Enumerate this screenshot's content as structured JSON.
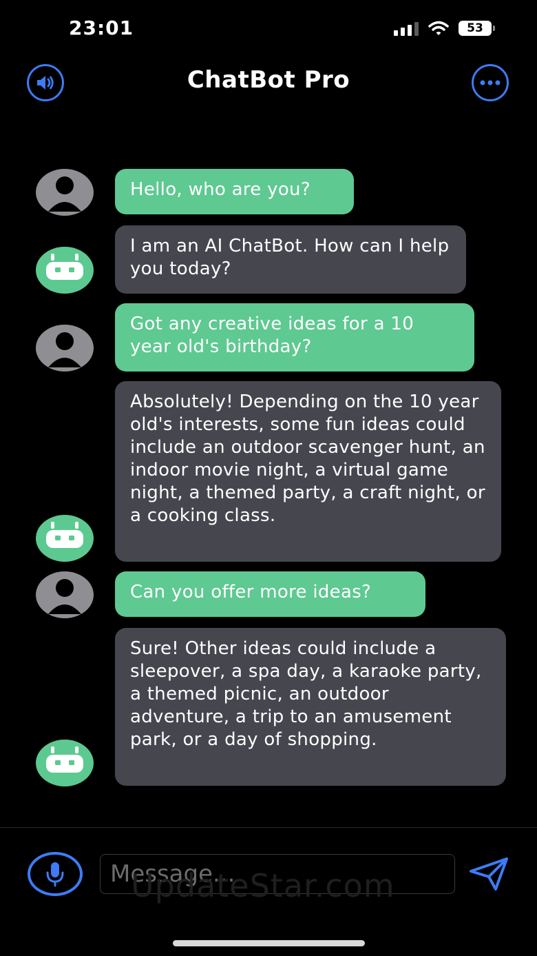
{
  "status_bar": {
    "time": "23:01",
    "battery_level": "53",
    "icons": [
      "signal-icon",
      "wifi-icon",
      "battery-icon"
    ]
  },
  "nav": {
    "title": "ChatBot Pro",
    "left_icon": "speaker-icon",
    "right_icon": "more-icon"
  },
  "messages": [
    {
      "sender": "user",
      "text": "Hello, who are you?"
    },
    {
      "sender": "bot",
      "text": "I am an AI ChatBot. How can I help you today?"
    },
    {
      "sender": "user",
      "text": "Got any creative ideas for a 10 year old's birthday?"
    },
    {
      "sender": "bot",
      "text": "Absolutely! Depending on the 10 year old's interests, some fun ideas could include an outdoor scavenger hunt, an indoor movie night, a virtual game night, a themed party, a craft night, or a cooking class."
    },
    {
      "sender": "user",
      "text": "Can you offer more ideas?"
    },
    {
      "sender": "bot",
      "text": "Sure! Other ideas could include a sleepover, a spa day, a karaoke party, a themed picnic, an outdoor adventure, a trip to an amusement park, or a day of shopping."
    }
  ],
  "composer": {
    "placeholder": "Message...",
    "mic_icon": "microphone-icon",
    "send_icon": "send-icon"
  },
  "watermark": "UpdateStar.com",
  "colors": {
    "accent": "#3d7cf5",
    "user_bubble": "#5ec991",
    "bot_bubble": "#46464f",
    "user_avatar": "#8e8e93",
    "bot_avatar": "#5cc990",
    "background": "#000000"
  }
}
